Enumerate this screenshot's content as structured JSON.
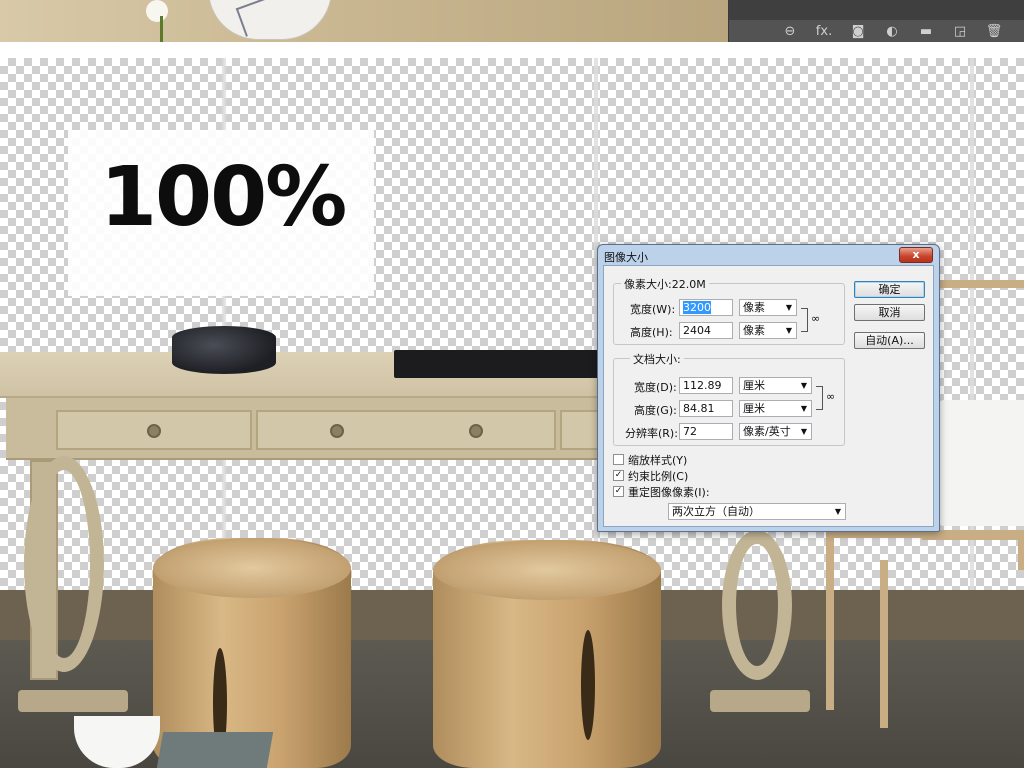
{
  "canvas": {
    "zoom_label": "100%"
  },
  "photoshop": {
    "layer_icons": [
      "link-icon",
      "fx-icon",
      "mask-icon",
      "adjustment-icon",
      "folder-icon",
      "new-layer-icon",
      "trash-icon"
    ],
    "fx_label": "fx."
  },
  "dialog": {
    "title": "图像大小",
    "close_label": "x",
    "pixel_group": {
      "legend": "像素大小:22.0M",
      "width_label": "宽度(W):",
      "width_value": "3200",
      "width_unit": "像素",
      "height_label": "高度(H):",
      "height_value": "2404",
      "height_unit": "像素"
    },
    "doc_group": {
      "legend": "文档大小:",
      "width_label": "宽度(D):",
      "width_value": "112.89",
      "width_unit": "厘米",
      "height_label": "高度(G):",
      "height_value": "84.81",
      "height_unit": "厘米",
      "res_label": "分辨率(R):",
      "res_value": "72",
      "res_unit": "像素/英寸"
    },
    "scale_styles": "缩放样式(Y)",
    "constrain": "约束比例(C)",
    "resample": "重定图像像素(I):",
    "resample_method": "两次立方（自动）",
    "checks": {
      "scale_styles": false,
      "constrain": true,
      "resample": true
    },
    "buttons": {
      "ok": "确定",
      "cancel": "取消",
      "auto": "自动(A)..."
    }
  }
}
